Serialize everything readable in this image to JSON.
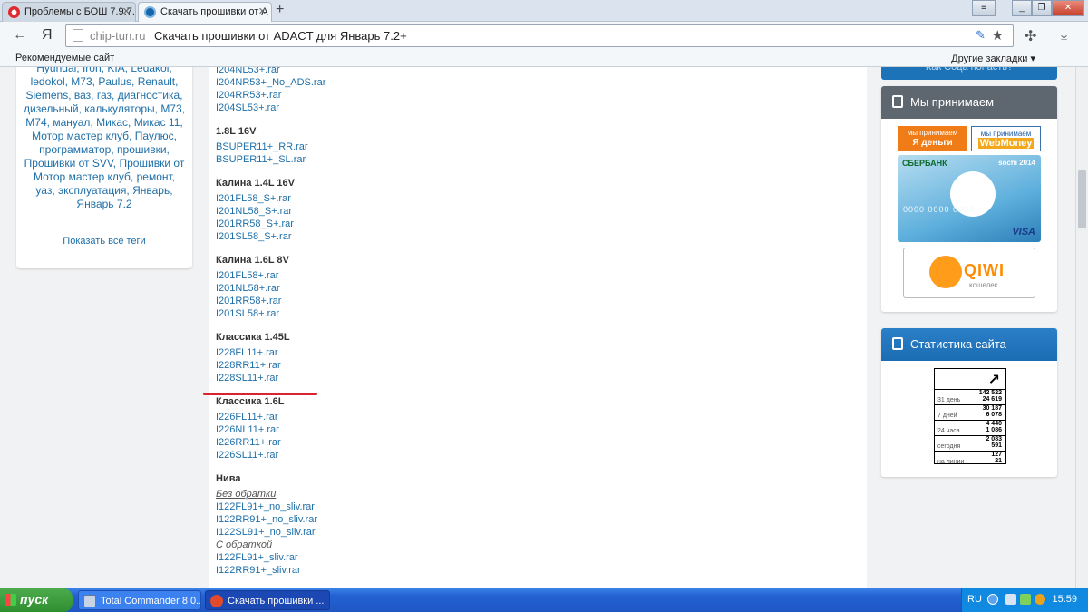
{
  "browser": {
    "tabs": [
      {
        "title": "Проблемы с БОШ 7.9.7.",
        "state": "inactive"
      },
      {
        "title": "Скачать прошивки от А",
        "state": "active"
      }
    ],
    "new_tab_symbol": "+",
    "back_symbol": "←",
    "yandex_symbol": "Я",
    "url": "chip-tun.ru",
    "page_title": "Скачать прошивки от ADACT для Январь 7.2+",
    "bookmarks": {
      "recommended": "Рекомендуемые сайт",
      "other": "Другие закладки ▾"
    }
  },
  "sidebar_left": {
    "tags": [
      "Hyundai,",
      "Iron,",
      "KIA,",
      "Ledakol,",
      "ledokol,",
      "M73,",
      "Paulus,",
      "Renault,",
      "Siemens,",
      "ваз,",
      "газ,",
      "диагностика,",
      "дизельный,",
      "калькуляторы,",
      "M73,",
      "M74,",
      "мануал,",
      "Микас,",
      "Микас 11,",
      "Мотор мастер клуб,",
      "Паулюс,",
      "программатор,",
      "прошивки,",
      "Прошивки от SVV,",
      "Прошивки от Мотор мастер клуб,",
      "ремонт,",
      "уаз,",
      "эксплуатация,",
      "Январь,",
      "Январь 7.2"
    ],
    "show_all_tags": "Показать все теги"
  },
  "firmware": {
    "items": [
      {
        "type": "link",
        "text": "I204NL53+.rar"
      },
      {
        "type": "link",
        "text": "I204NR53+_No_ADS.rar"
      },
      {
        "type": "link",
        "text": "I204RR53+.rar"
      },
      {
        "type": "link",
        "text": "I204SL53+.rar"
      },
      {
        "type": "head",
        "text": "1.8L 16V"
      },
      {
        "type": "link",
        "text": "BSUPER11+_RR.rar"
      },
      {
        "type": "link",
        "text": "BSUPER11+_SL.rar"
      },
      {
        "type": "head",
        "text": "Калина 1.4L 16V"
      },
      {
        "type": "link",
        "text": "I201FL58_S+.rar"
      },
      {
        "type": "link",
        "text": "I201NL58_S+.rar"
      },
      {
        "type": "link",
        "text": "I201RR58_S+.rar"
      },
      {
        "type": "link",
        "text": "I201SL58_S+.rar"
      },
      {
        "type": "head",
        "text": "Калина 1.6L 8V"
      },
      {
        "type": "link",
        "text": "I201FL58+.rar"
      },
      {
        "type": "link",
        "text": "I201NL58+.rar"
      },
      {
        "type": "link",
        "text": "I201RR58+.rar"
      },
      {
        "type": "link",
        "text": "I201SL58+.rar"
      },
      {
        "type": "head",
        "text": "Классика 1.45L"
      },
      {
        "type": "link",
        "text": "I228FL11+.rar"
      },
      {
        "type": "link",
        "text": "I228RR11+.rar"
      },
      {
        "type": "link",
        "text": "I228SL11+.rar"
      },
      {
        "type": "head",
        "text": "Классика 1.6L"
      },
      {
        "type": "link",
        "text": "I226FL11+.rar"
      },
      {
        "type": "link",
        "text": "I226NL11+.rar"
      },
      {
        "type": "link",
        "text": "I226RR11+.rar"
      },
      {
        "type": "link",
        "text": "I226SL11+.rar"
      },
      {
        "type": "head",
        "text": "Нива"
      },
      {
        "type": "sub",
        "text": "Без обратки"
      },
      {
        "type": "link",
        "text": "I122FL91+_no_sliv.rar"
      },
      {
        "type": "link",
        "text": "I122RR91+_no_sliv.rar"
      },
      {
        "type": "link",
        "text": "I122SL91+_no_sliv.rar"
      },
      {
        "type": "sub",
        "text": "С обраткой"
      },
      {
        "type": "link",
        "text": "I122FL91+_sliv.rar"
      },
      {
        "type": "link",
        "text": "I122RR91+_sliv.rar"
      }
    ]
  },
  "sidebar_right": {
    "top_strip": "Как Сода попасть?",
    "payments": {
      "title": "Мы принимаем",
      "yandex": {
        "line1": "мы принимаем",
        "line2": "Я деньги"
      },
      "webmoney": {
        "line1": "мы принимаем",
        "line2": "WebMoney"
      },
      "card": {
        "bank": "СБЕРБАНК",
        "sochi": "sochi 2014",
        "number": "0000 0000 0000",
        "brand": "VISA"
      },
      "qiwi": {
        "name": "QIWI",
        "sub": "кошелек"
      }
    },
    "stats": {
      "title": "Статистика сайта",
      "rows": [
        {
          "label": "31 день",
          "v1": "142 522",
          "v2": "24 619"
        },
        {
          "label": "7 дней",
          "v1": "30 187",
          "v2": "6 078"
        },
        {
          "label": "24 часа",
          "v1": "4 440",
          "v2": "1 086"
        },
        {
          "label": "сегодня",
          "v1": "2 083",
          "v2": "591"
        },
        {
          "label": "на линии",
          "v1": "127",
          "v2": "21"
        }
      ]
    }
  },
  "taskbar": {
    "start": "пуск",
    "buttons": [
      {
        "label": "Total Commander 8.0..."
      },
      {
        "label": "Скачать прошивки ..."
      }
    ],
    "lang": "RU",
    "clock": "15:59"
  },
  "colors": {
    "link": "#1e6fa8",
    "highlight": "#d9232d",
    "panel_header": "#5e6770",
    "panel_header_blue": "#1b6db3"
  }
}
